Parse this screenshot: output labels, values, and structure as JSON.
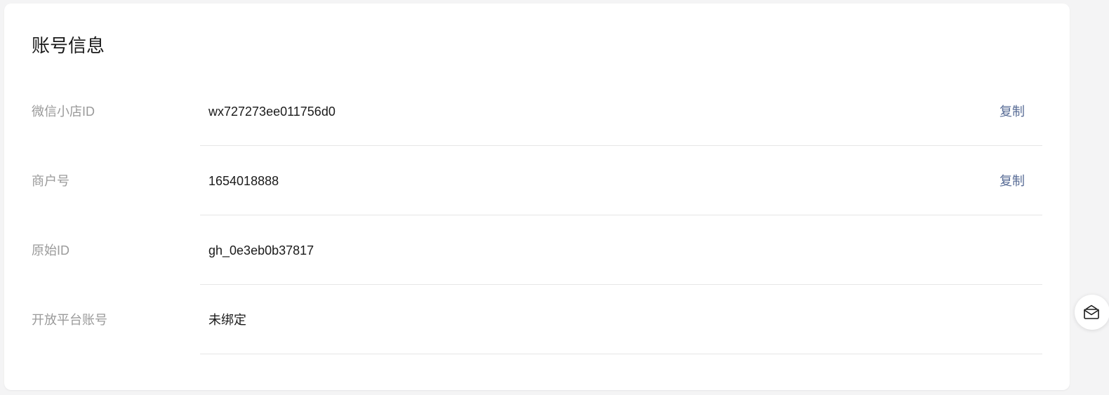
{
  "card": {
    "title": "账号信息"
  },
  "rows": [
    {
      "label": "微信小店ID",
      "value": "wx727273ee011756d0",
      "action": "复制"
    },
    {
      "label": "商户号",
      "value": "1654018888",
      "action": "复制"
    },
    {
      "label": "原始ID",
      "value": "gh_0e3eb0b37817"
    },
    {
      "label": "开放平台账号",
      "value": "未绑定"
    }
  ],
  "float_button": {
    "icon": "envelope-icon"
  },
  "colors": {
    "background": "#f4f4f5",
    "card": "#ffffff",
    "label": "#9a9a9a",
    "value": "#1a1a1a",
    "link": "#576b95",
    "divider": "#e6e6e6"
  }
}
